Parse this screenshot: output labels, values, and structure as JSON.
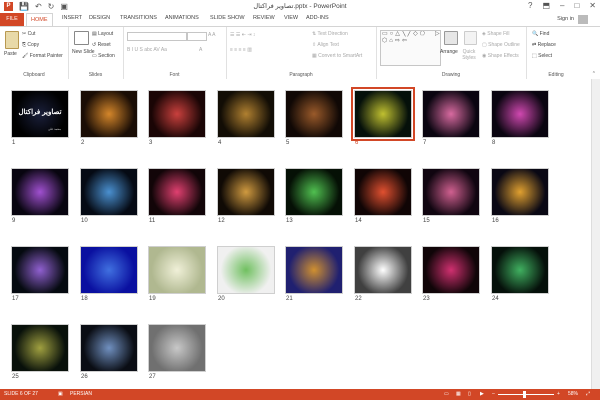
{
  "window": {
    "title": "تصاویر فراکتال.pptx - PowerPoint",
    "app_icon": "P",
    "sign_in": "Sign in",
    "min": "–",
    "max": "□",
    "close": "✕",
    "help": "?"
  },
  "tabs": [
    "FILE",
    "HOME",
    "INSERT",
    "DESIGN",
    "TRANSITIONS",
    "ANIMATIONS",
    "SLIDE SHOW",
    "REVIEW",
    "VIEW",
    "ADD-INS"
  ],
  "ribbon": {
    "clipboard": {
      "label": "Clipboard",
      "paste": "Paste",
      "cut": "Cut",
      "copy": "Copy",
      "format_painter": "Format Painter"
    },
    "slides": {
      "label": "Slides",
      "new_slide": "New Slide",
      "layout": "Layout",
      "reset": "Reset",
      "section": "Section"
    },
    "font": {
      "label": "Font"
    },
    "paragraph": {
      "label": "Paragraph",
      "text_direction": "Text Direction",
      "align_text": "Align Text",
      "convert_smartart": "Convert to SmartArt"
    },
    "drawing": {
      "label": "Drawing",
      "arrange": "Arrange",
      "quick_styles": "Quick Styles",
      "shape_fill": "Shape Fill",
      "shape_outline": "Shape Outline",
      "shape_effects": "Shape Effects"
    },
    "editing": {
      "label": "Editing",
      "find": "Find",
      "replace": "Replace",
      "select": "Select"
    }
  },
  "slides": [
    {
      "n": "1",
      "c1": "#1a1f3a",
      "c2": "#000"
    },
    {
      "n": "2",
      "c1": "#d4862a",
      "c2": "#1a0d05"
    },
    {
      "n": "3",
      "c1": "#c9403d",
      "c2": "#1a0505"
    },
    {
      "n": "4",
      "c1": "#b08030",
      "c2": "#120d05"
    },
    {
      "n": "5",
      "c1": "#9a5a2a",
      "c2": "#100805"
    },
    {
      "n": "6",
      "c1": "#c0c030",
      "c2": "#05100a"
    },
    {
      "n": "7",
      "c1": "#d86aa0",
      "c2": "#0a0510"
    },
    {
      "n": "8",
      "c1": "#d048b0",
      "c2": "#0a0510"
    },
    {
      "n": "9",
      "c1": "#a050d0",
      "c2": "#080510"
    },
    {
      "n": "10",
      "c1": "#4a90d0",
      "c2": "#050a14"
    },
    {
      "n": "11",
      "c1": "#e04070",
      "c2": "#120508"
    },
    {
      "n": "12",
      "c1": "#d09a40",
      "c2": "#100a05"
    },
    {
      "n": "13",
      "c1": "#50c050",
      "c2": "#051005"
    },
    {
      "n": "14",
      "c1": "#e05030",
      "c2": "#100505"
    },
    {
      "n": "15",
      "c1": "#d06090",
      "c2": "#100510"
    },
    {
      "n": "16",
      "c1": "#e0a030",
      "c2": "#0a0814"
    },
    {
      "n": "17",
      "c1": "#9060d0",
      "c2": "#050a10"
    },
    {
      "n": "18",
      "c1": "#4070e0",
      "c2": "#0a10a0"
    },
    {
      "n": "19",
      "c1": "#f0f0d8",
      "c2": "#b0b890"
    },
    {
      "n": "20",
      "c1": "#70c060",
      "c2": "#f0f0f0"
    },
    {
      "n": "21",
      "c1": "#d09030",
      "c2": "#202070"
    },
    {
      "n": "22",
      "c1": "#ffffff",
      "c2": "#404040"
    },
    {
      "n": "23",
      "c1": "#d03070",
      "c2": "#100508"
    },
    {
      "n": "24",
      "c1": "#40b060",
      "c2": "#05100a"
    },
    {
      "n": "25",
      "c1": "#a0a040",
      "c2": "#08100a"
    },
    {
      "n": "26",
      "c1": "#7090c0",
      "c2": "#0a0d14"
    },
    {
      "n": "27",
      "c1": "#c8c8c8",
      "c2": "#707070"
    }
  ],
  "slide1": {
    "title": "تصاویر فراکتال",
    "sub": "محمد علی"
  },
  "selected_slide": "6",
  "status": {
    "slide_info": "SLIDE 6 OF 27",
    "language": "PERSIAN",
    "zoom": "58%"
  },
  "colors": {
    "accent": "#d24726"
  }
}
